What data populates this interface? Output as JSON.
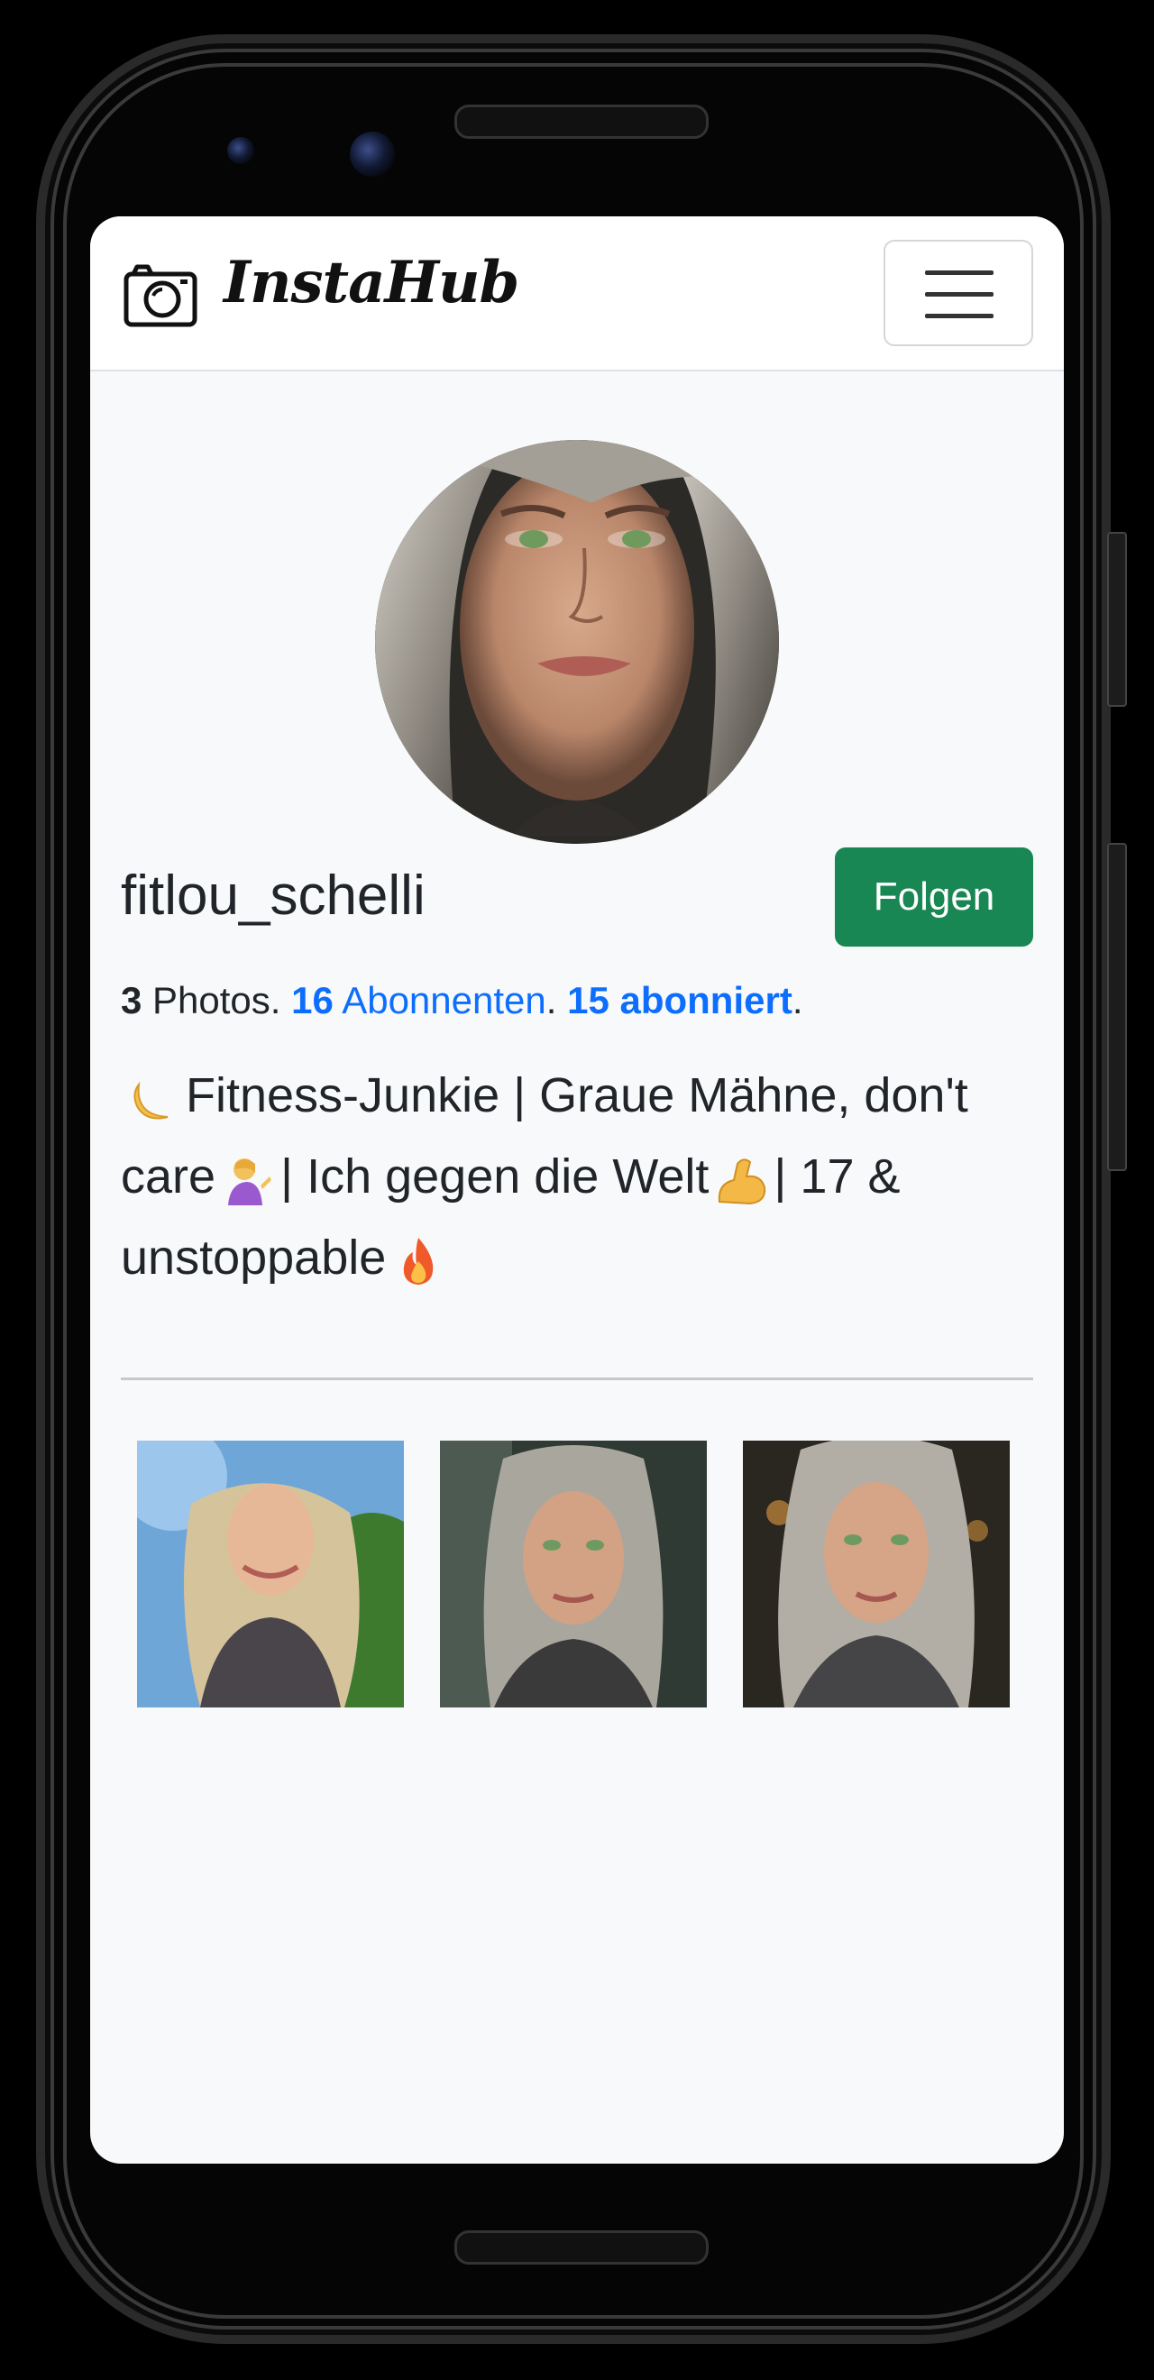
{
  "app": {
    "brand_name": "InstaHub",
    "brand_icon": "camera-icon",
    "menu_icon": "hamburger-menu-icon"
  },
  "profile": {
    "username": "fitlou_schelli",
    "follow_label": "Folgen",
    "stats": {
      "photos_count": "3",
      "photos_label": " Photos. ",
      "followers_count": "16",
      "followers_label": " Abonnenten",
      "sep1": ". ",
      "following_text": "15 abonniert",
      "end": "."
    },
    "bio": {
      "line1": "Fitness-Junkie | Graue Mähne, don't care",
      "line2": "| Ich gegen die Welt",
      "line3": "| 17 & unstoppable",
      "emojis": [
        "crescent-moon-icon",
        "woman-tipping-hand-icon",
        "flexed-biceps-icon",
        "fire-icon"
      ]
    },
    "avatar_description": "profile-photo"
  },
  "posts": [
    {
      "name": "post-1"
    },
    {
      "name": "post-2"
    },
    {
      "name": "post-3"
    }
  ],
  "colors": {
    "follow_button": "#198754",
    "link": "#0d6efd",
    "page_bg": "#f8f9fa"
  }
}
